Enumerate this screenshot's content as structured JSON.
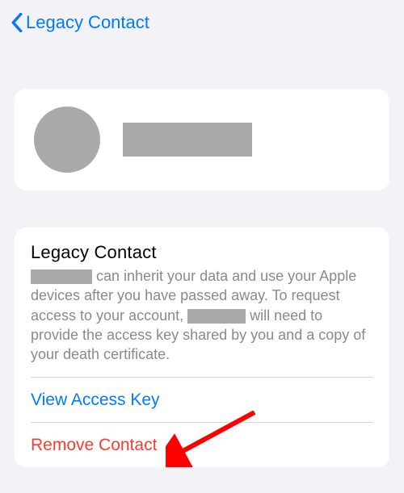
{
  "nav": {
    "back_label": "Legacy Contact"
  },
  "contact_card": {},
  "detail": {
    "section_title": "Legacy Contact",
    "desc_part1": " can inherit your data and use your Apple devices after you have passed away. To request access to your account, ",
    "desc_part2": " will need to provide the access key shared by you and a copy of your death certificate.",
    "view_key_label": "View Access Key",
    "remove_label": "Remove Contact"
  },
  "colors": {
    "link": "#007aff",
    "destructive": "#ff3b30",
    "redact": "#a9a9a9",
    "bg": "#f2f2f7"
  }
}
